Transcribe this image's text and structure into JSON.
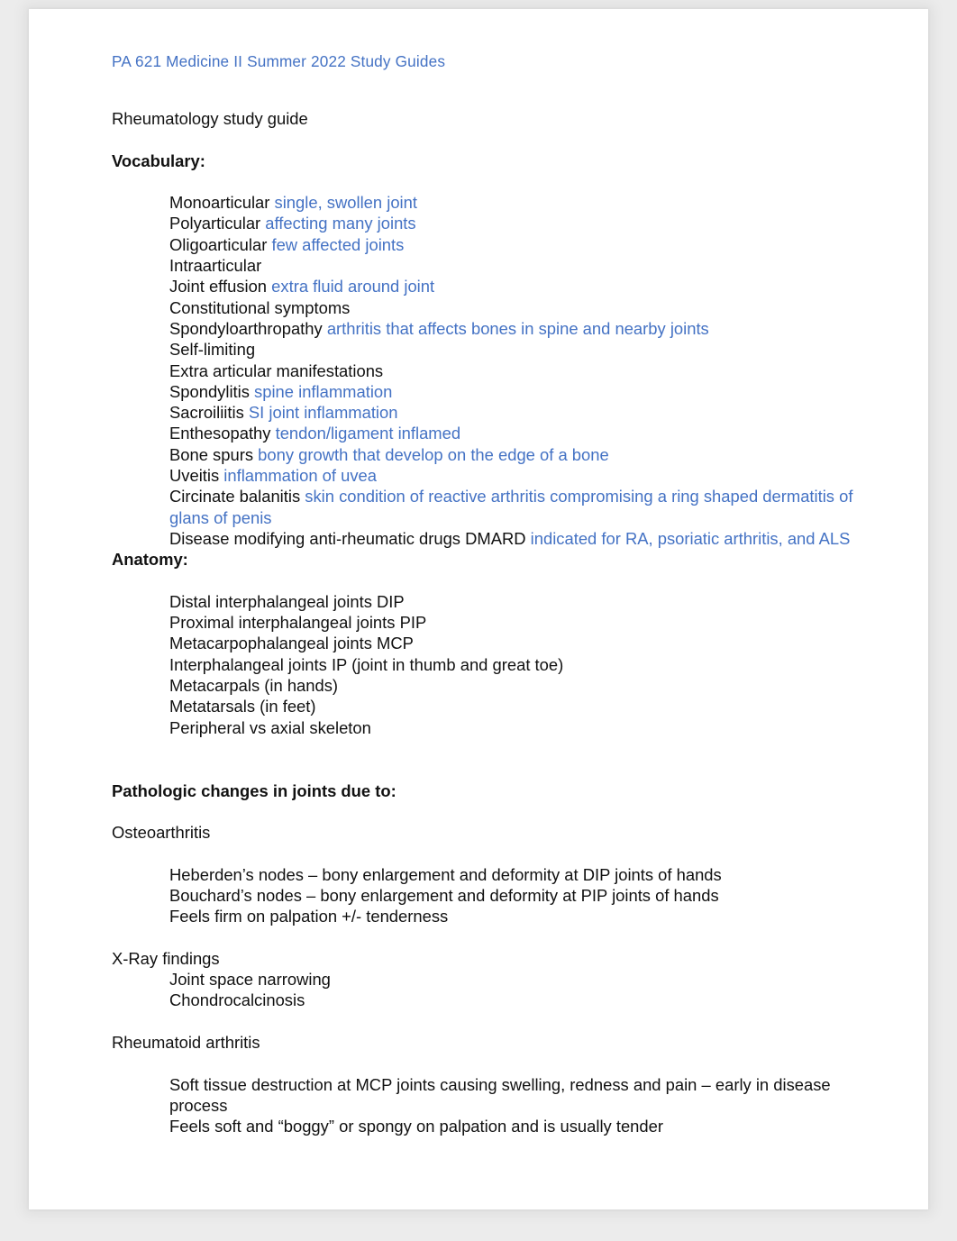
{
  "document": {
    "header_link": "PA 621 Medicine II Summer 2022 Study Guides",
    "title_line": "Rheumatology study guide"
  },
  "vocabulary": {
    "heading": "Vocabulary:",
    "entries": [
      {
        "term": "Monoarticular ",
        "definition": "single, swollen joint"
      },
      {
        "term": "Polyarticular ",
        "definition": "affecting many joints"
      },
      {
        "term": "Oligoarticular ",
        "definition": "few affected joints"
      },
      {
        "term": "Intraarticular",
        "definition": ""
      },
      {
        "term": "Joint effusion ",
        "definition": "extra fluid around joint"
      },
      {
        "term": "Constitutional symptoms",
        "definition": ""
      },
      {
        "term": "Spondyloarthropathy ",
        "definition": "arthritis that affects bones in spine and nearby joints"
      },
      {
        "term": "Self-limiting",
        "definition": ""
      },
      {
        "term": "Extra articular manifestations",
        "definition": ""
      },
      {
        "term": "Spondylitis ",
        "definition": "spine inflammation"
      },
      {
        "term": "Sacroiliitis ",
        "definition": "SI joint inflammation"
      },
      {
        "term": "Enthesopathy ",
        "definition": "tendon/ligament inflamed"
      },
      {
        "term": "Bone spurs ",
        "definition": " bony growth that develop on the edge of a bone"
      },
      {
        "term": "Uveitis ",
        "definition": "inflammation of uvea"
      },
      {
        "term": "Circinate balanitis ",
        "definition": " skin condition of reactive arthritis compromising a ring shaped dermatitis of glans of penis"
      },
      {
        "term": "Disease modifying anti-rheumatic drugs DMARD ",
        "definition": "indicated for RA, psoriatic arthritis, and ALS"
      }
    ]
  },
  "anatomy": {
    "heading": "Anatomy:",
    "items": [
      "Distal interphalangeal joints DIP",
      "Proximal interphalangeal joints PIP",
      "Metacarpophalangeal joints MCP",
      "Interphalangeal joints IP (joint in thumb and great toe)",
      "Metacarpals (in hands)",
      "Metatarsals (in feet)",
      "Peripheral vs axial skeleton"
    ]
  },
  "pathologic": {
    "heading": "Pathologic changes in joints due to:",
    "sections": [
      {
        "label": "Osteoarthritis",
        "items": [
          "Heberden’s nodes – bony enlargement and deformity at DIP joints of hands",
          "Bouchard’s nodes – bony enlargement and deformity at PIP joints of hands",
          "Feels firm on palpation +/- tenderness"
        ]
      },
      {
        "label": "X-Ray findings",
        "items": [
          "Joint space narrowing",
          "Chondrocalcinosis"
        ]
      },
      {
        "label": "Rheumatoid arthritis",
        "items": [
          "Soft tissue destruction at MCP joints causing swelling, redness and pain – early in disease process",
          "Feels soft and “boggy” or spongy on palpation and is usually tender"
        ]
      }
    ]
  },
  "colors": {
    "accent_blue": "#4472C4",
    "body_text": "#111111",
    "page_background": "#FFFFFF",
    "canvas_background": "#ECECEC"
  }
}
